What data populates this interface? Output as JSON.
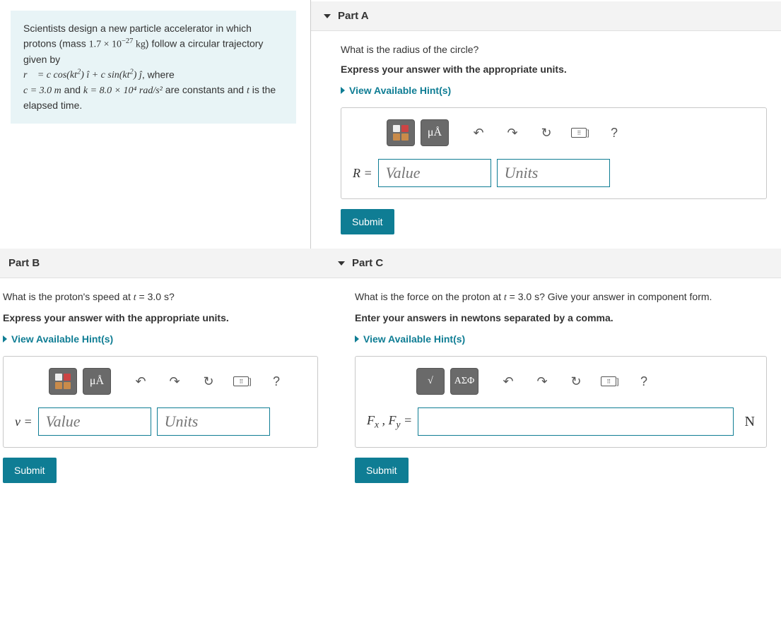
{
  "problem": {
    "line1_a": "Scientists design a new particle accelerator in which protons (mass ",
    "mass": "1.7 × 10",
    "mass_exp": "−27",
    "mass_unit": " kg",
    "line1_b": ") follow a circular trajectory given by",
    "eq_prefix": "r⃗ = c cos(kt²) î + c sin(kt²) ĵ",
    "eq_suffix": ", where",
    "c_val": "c = 3.0 m",
    "and": " and ",
    "k_val": "k = 8.0 × 10⁴ rad/s²",
    "const_suffix": " are constants and ",
    "t_var": "t",
    "time_suffix": " is the elapsed time."
  },
  "partA": {
    "title": "Part A",
    "question": "What is the radius of the circle?",
    "instruction": "Express your answer with the appropriate units.",
    "hints": "View Available Hint(s)",
    "var": "R =",
    "value_ph": "Value",
    "units_ph": "Units",
    "submit": "Submit",
    "mu": "μÅ",
    "help": "?"
  },
  "partB": {
    "title": "Part B",
    "question_a": "What is the proton's speed at ",
    "t_eq": "t",
    "question_b": " = 3.0 s?",
    "instruction": "Express your answer with the appropriate units.",
    "hints": "View Available Hint(s)",
    "var": "v =",
    "value_ph": "Value",
    "units_ph": "Units",
    "submit": "Submit",
    "mu": "μÅ",
    "help": "?"
  },
  "partC": {
    "title": "Part C",
    "question_a": "What is the force on the proton at ",
    "t_eq": "t",
    "question_b": " = 3.0 s? Give your answer in component form.",
    "instruction": "Enter your answers in newtons separated by a comma.",
    "hints": "View Available Hint(s)",
    "var": "Fₓ , Fᵧ =",
    "unit": "N",
    "submit": "Submit",
    "greek": "ΑΣΦ",
    "help": "?"
  },
  "icons": {
    "undo": "↶",
    "redo": "↷",
    "reset": "↻",
    "keyboard": "⌨",
    "bracket": "]"
  }
}
